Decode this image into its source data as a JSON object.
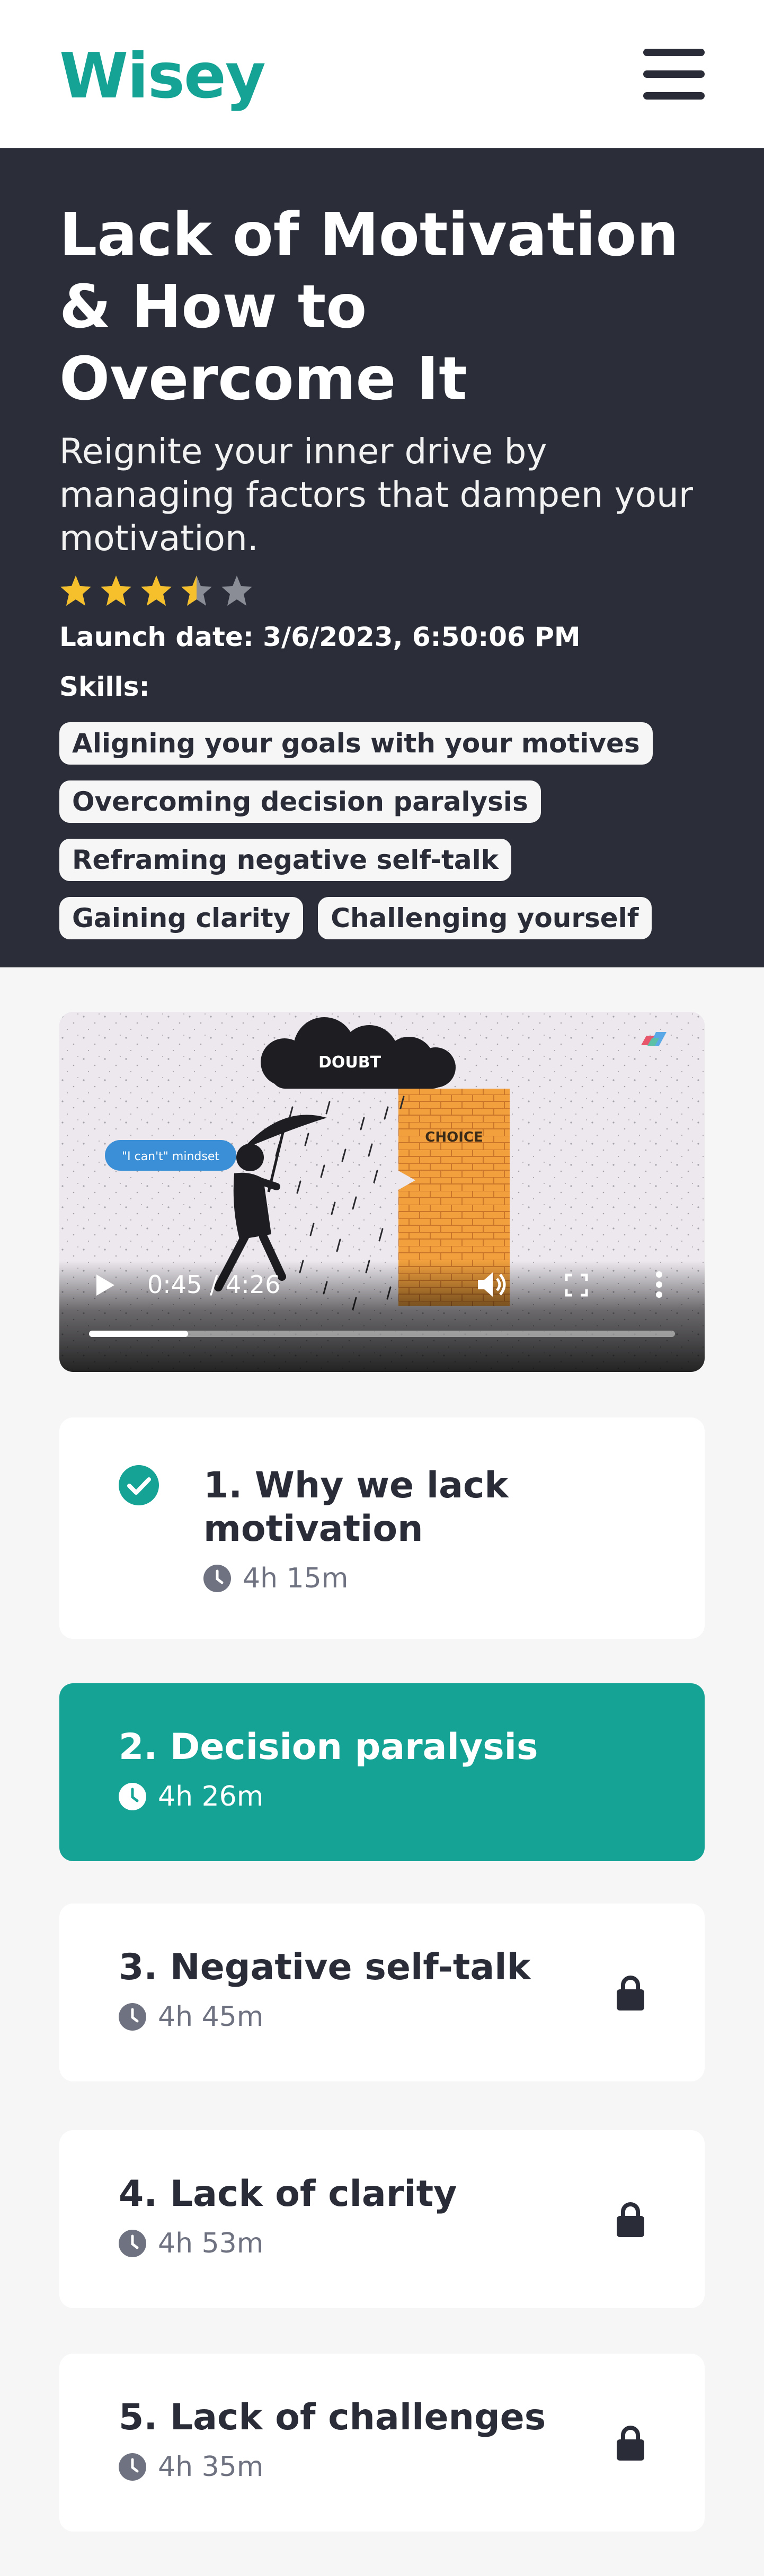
{
  "app": {
    "logo": "Wisey"
  },
  "header": {
    "menu_icon": "hamburger-menu-icon"
  },
  "course": {
    "title": "Lack of Motivation & How to Overcome It",
    "subtitle": "Reignite your inner drive by managing factors that dampen your motivation.",
    "rating": 3.5,
    "rating_max": 5,
    "launch": "Launch date: 3/6/2023, 6:50:06 PM",
    "skills_label": "Skills:",
    "skills": [
      "Aligning your goals with your motives",
      "Overcoming decision paralysis",
      "Reframing negative self-talk",
      "Gaining clarity",
      "Challenging yourself"
    ]
  },
  "video": {
    "time": "0:45 / 4:26",
    "progress": 0.169,
    "scene": {
      "cloud_text": "DOUBT",
      "wall_text": "CHOICE",
      "bubble_text": "\"I can't\" mindset"
    }
  },
  "lessons": [
    {
      "title": "1. Why we lack motivation",
      "duration": "4h 15m",
      "state": "completed"
    },
    {
      "title": "2. Decision paralysis",
      "duration": "4h 26m",
      "state": "active"
    },
    {
      "title": "3. Negative self-talk",
      "duration": "4h 45m",
      "state": "locked"
    },
    {
      "title": "4. Lack of clarity",
      "duration": "4h 53m",
      "state": "locked"
    },
    {
      "title": "5. Lack of challenges",
      "duration": "4h 35m",
      "state": "locked"
    }
  ],
  "colors": {
    "brand": "#14a395",
    "hero_bg": "#2b2e39",
    "star": "#f5c02c",
    "star_empty": "#8a8d96"
  }
}
